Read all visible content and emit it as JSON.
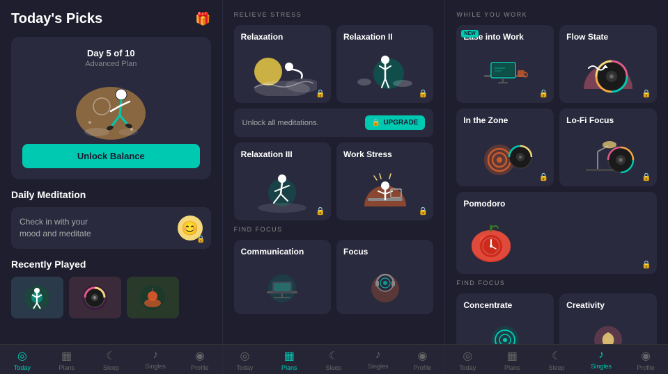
{
  "panel1": {
    "title": "Today's Picks",
    "day_label": "Day 5 of 10",
    "plan_label": "Advanced Plan",
    "unlock_btn": "Unlock Balance",
    "daily_meditation_title": "Daily Meditation",
    "mood_text_line1": "Check in with your",
    "mood_text_line2": "mood and meditate",
    "recently_played_title": "Recently Played"
  },
  "panel2": {
    "section_label": "RELIEVE STRESS",
    "find_focus_label": "FIND FOCUS",
    "upgrade_text": "Unlock all meditations.",
    "upgrade_btn": "UPGRADE",
    "cards_row1": [
      {
        "title": "Relaxation",
        "locked": true
      },
      {
        "title": "Relaxation II",
        "locked": true
      }
    ],
    "cards_row2": [
      {
        "title": "Relaxation III",
        "locked": true
      },
      {
        "title": "Work Stress",
        "locked": true
      }
    ],
    "cards_row3": [
      {
        "title": "Communication",
        "locked": false
      },
      {
        "title": "Focus",
        "locked": false
      }
    ]
  },
  "panel3": {
    "while_you_work_label": "WHILE YOU WORK",
    "find_focus_label": "FIND FOCUS",
    "cards_row1": [
      {
        "title": "Ease into Work",
        "locked": true,
        "new": true
      },
      {
        "title": "Flow State",
        "locked": true,
        "new": false
      }
    ],
    "cards_row2": [
      {
        "title": "In the Zone",
        "locked": true,
        "new": false
      },
      {
        "title": "Lo-Fi Focus",
        "locked": true,
        "new": false
      }
    ],
    "cards_row3": [
      {
        "title": "Pomodoro",
        "locked": true,
        "new": false,
        "single": true
      }
    ],
    "cards_row4": [
      {
        "title": "Concentrate",
        "locked": false,
        "new": false
      },
      {
        "title": "Creativity",
        "locked": false,
        "new": false
      }
    ]
  },
  "nav": {
    "items": [
      {
        "label": "Today",
        "icon": "◎",
        "active": false
      },
      {
        "label": "Plans",
        "icon": "▦",
        "active": false
      },
      {
        "label": "Sleep",
        "icon": "☾",
        "active": false
      },
      {
        "label": "Singles",
        "icon": "♪",
        "active": false
      },
      {
        "label": "Profile",
        "icon": "◉",
        "active": false
      }
    ],
    "nav2_active": 1,
    "nav3_active": 3
  }
}
